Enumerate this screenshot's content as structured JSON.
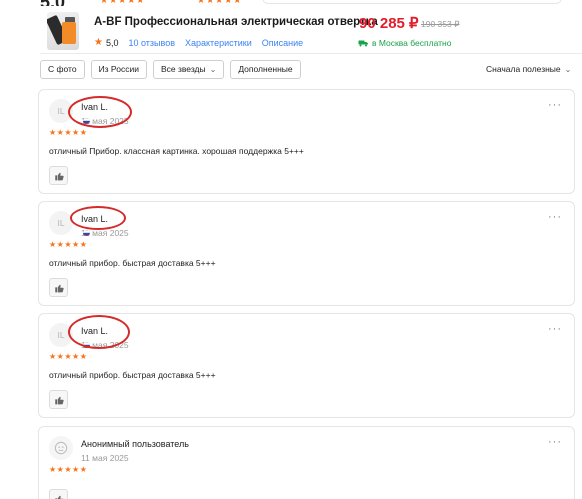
{
  "top_strip": {
    "rating_partial": "5.0",
    "stars": "★★★★★"
  },
  "product": {
    "title": "A-BF Профессиональная электрическая отвертка",
    "rating": "5,0",
    "reviews_link": "10 отзывов",
    "characteristics_link": "Характеристики",
    "description_link": "Описание",
    "price": "90 285 ₽",
    "old_price": "190 353 ₽",
    "delivery": "в Москва бесплатно"
  },
  "filters": {
    "with_photo": "С фото",
    "from_russia": "Из России",
    "all_stars": "Все звезды",
    "supplemented": "Дополненные",
    "sort": "Сначала полезные"
  },
  "reviews": [
    {
      "initials": "IL",
      "name": "Ivan L.",
      "date": "11 мая 2025",
      "stars": "★★★★★",
      "text": "отличный Прибор. классная картинка. хорошая поддержка 5+++",
      "more": "···"
    },
    {
      "initials": "IL",
      "name": "Ivan L.",
      "date": "11 мая 2025",
      "stars": "★★★★★",
      "text": "отличный прибор. быстрая доставка  5+++",
      "more": "···"
    },
    {
      "initials": "IL",
      "name": "Ivan L.",
      "date": "11 мая 2025",
      "stars": "★★★★★",
      "text": "отличный прибор. быстрая доставка  5+++",
      "more": "···"
    },
    {
      "initials": "",
      "name": "Анонимный пользователь",
      "date": "11 мая 2025",
      "stars": "★★★★★",
      "text": "",
      "more": "···"
    }
  ],
  "colors": {
    "accent_star": "#f97316",
    "price_red": "#e11d2a",
    "delivery_green": "#16a34a",
    "link_blue": "#3b82f6",
    "annotation_red": "#d42a2a"
  },
  "icons": {
    "like": "thumbs-up-icon",
    "more": "more-dots-icon",
    "anon": "anonymous-face-icon",
    "delivery": "truck-icon",
    "chevron": "chevron-down-icon"
  }
}
